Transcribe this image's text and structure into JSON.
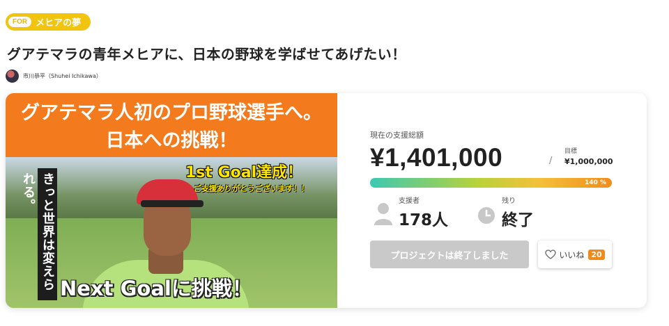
{
  "badge": {
    "prefix": "FOR",
    "name": "メヒアの夢"
  },
  "project": {
    "title": "グアテマラの青年メヒアに、日本の野球を学ばせてあげたい！"
  },
  "author": {
    "name": "市川恭平（Shuhei Ichikawa）"
  },
  "hero": {
    "line1": "グアテマラ人初のプロ野球選手へ。",
    "line2": "日本への挑戦！",
    "goal_achieved": "1st Goal達成！",
    "thanks": "ご支援ありがとうございます！！",
    "vertical_text": "きっと世界は変えられる。",
    "next_goal": "Next Goalに挑戦！"
  },
  "funding": {
    "raised_label": "現在の支援総額",
    "raised_amount": "¥1,401,000",
    "slash": "/",
    "goal_label": "目標",
    "goal_amount": "¥1,000,000",
    "progress_text": "140 %",
    "progress_fraction": 1.0
  },
  "stats": {
    "supporters_label": "支援者",
    "supporters_value": "178人",
    "remaining_label": "残り",
    "remaining_value": "終了"
  },
  "actions": {
    "end_label": "プロジェクトは終了しました",
    "like_label": "いいね",
    "like_count": "20"
  },
  "colors": {
    "badge": "#f1c40f",
    "hero_banner": "#f37b1d",
    "like_count": "#f08a1c",
    "disabled_button": "#c9c9c9"
  }
}
